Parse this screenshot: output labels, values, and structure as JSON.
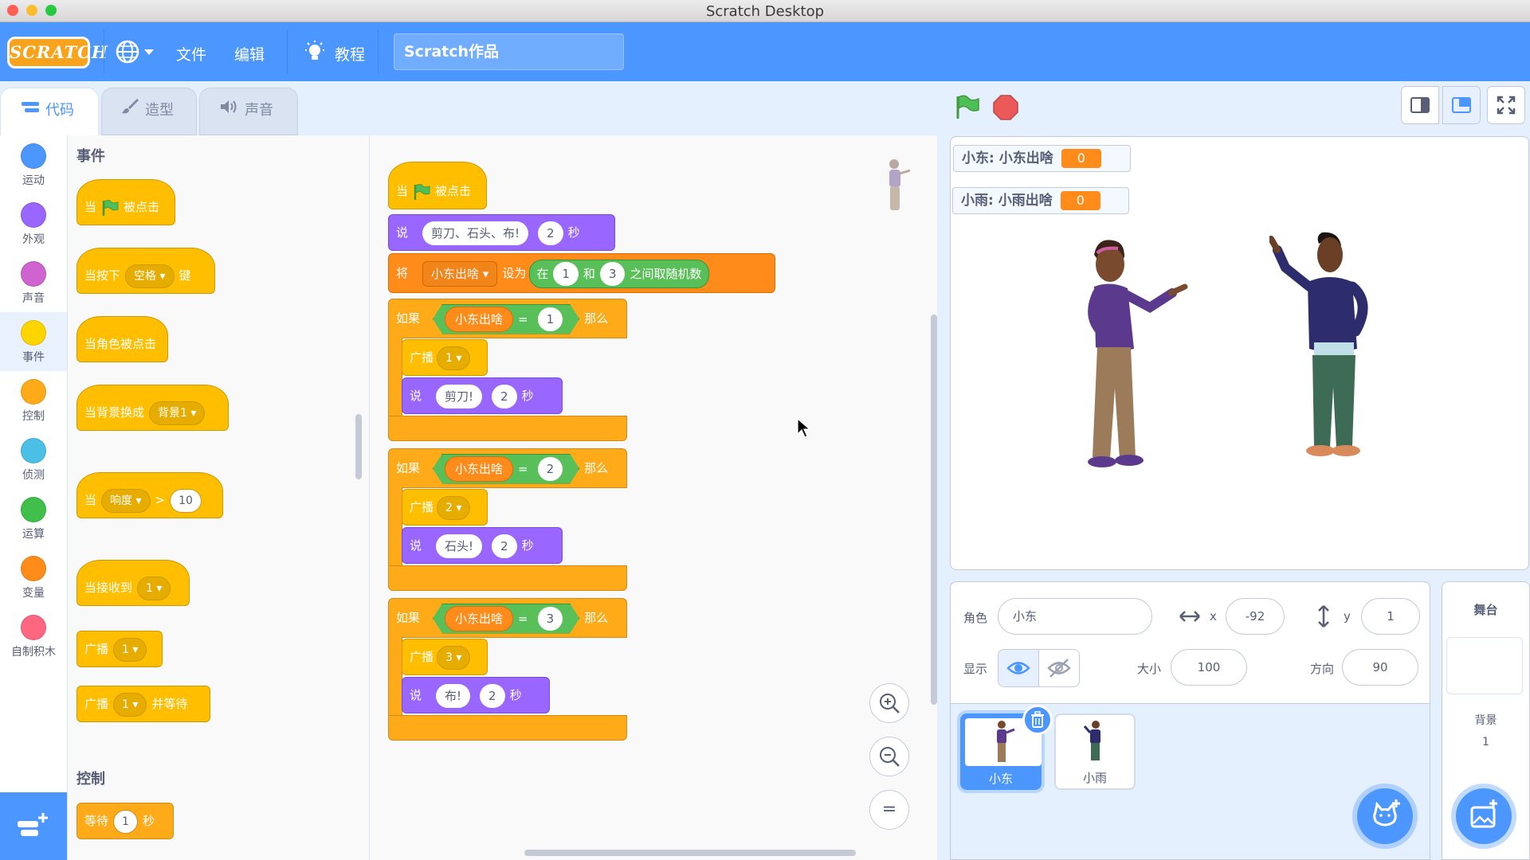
{
  "window": {
    "title": "Scratch Desktop"
  },
  "menubar": {
    "logo": "SCRATCH",
    "file": "文件",
    "edit": "编辑",
    "tutorials": "教程",
    "project_title": "Scratch作品"
  },
  "tabs": {
    "code": "代码",
    "costumes": "造型",
    "sounds": "声音"
  },
  "categories": [
    {
      "label": "运动",
      "color": "#4c97ff"
    },
    {
      "label": "外观",
      "color": "#9966ff"
    },
    {
      "label": "声音",
      "color": "#cf63cf"
    },
    {
      "label": "事件",
      "color": "#ffd500"
    },
    {
      "label": "控制",
      "color": "#ffab19"
    },
    {
      "label": "侦测",
      "color": "#4cbfe6"
    },
    {
      "label": "运算",
      "color": "#40bf4a"
    },
    {
      "label": "变量",
      "color": "#ff8c1a"
    },
    {
      "label": "自制积木",
      "color": "#ff6680"
    }
  ],
  "palette": {
    "events_header": "事件",
    "control_header": "控制",
    "when": "当",
    "clicked": "被点击",
    "when_key_pressed": "当按下",
    "key_space": "空格",
    "key": "键",
    "when_sprite_clicked": "当角色被点击",
    "when_backdrop_switches": "当背景换成",
    "backdrop1": "背景1",
    "loudness": "响度",
    "gt": ">",
    "loudness_value": "10",
    "when_receive": "当接收到",
    "msg1": "1",
    "broadcast": "广播",
    "and_wait": "并等待",
    "wait": "等待",
    "wait_value": "1",
    "seconds": "秒"
  },
  "script": {
    "when": "当",
    "clicked": "被点击",
    "say": "说",
    "say_text": "剪刀、石头、布!",
    "say_secs": "2",
    "secs": "秒",
    "set": "将",
    "var_name": "小东出啥",
    "set_to": "设为",
    "random_in": "在",
    "random_from": "1",
    "random_and": "和",
    "random_to": "3",
    "random_pick": "之间取随机数",
    "if": "如果",
    "then": "那么",
    "eq": "=",
    "broadcast": "广播",
    "cases": [
      {
        "value": "1",
        "msg": "1",
        "say": "剪刀!",
        "secs": "2"
      },
      {
        "value": "2",
        "msg": "2",
        "say": "石头!",
        "secs": "2"
      },
      {
        "value": "3",
        "msg": "3",
        "say": "布!",
        "secs": "2"
      }
    ]
  },
  "zoom": {
    "in": "+",
    "out": "−",
    "reset": "="
  },
  "stage": {
    "monitors": [
      {
        "label": "小东: 小东出啥",
        "value": "0"
      },
      {
        "label": "小雨: 小雨出啥",
        "value": "0"
      }
    ]
  },
  "sprite_info": {
    "sprite_label": "角色",
    "sprite_name": "小东",
    "x_label": "x",
    "x_value": "-92",
    "y_label": "y",
    "y_value": "1",
    "show_label": "显示",
    "size_label": "大小",
    "size_value": "100",
    "direction_label": "方向",
    "direction_value": "90"
  },
  "sprites": [
    {
      "name": "小东",
      "selected": true
    },
    {
      "name": "小雨",
      "selected": false
    }
  ],
  "stage_panel": {
    "title": "舞台",
    "backdrops_label": "背景",
    "backdrops_count": "1"
  }
}
